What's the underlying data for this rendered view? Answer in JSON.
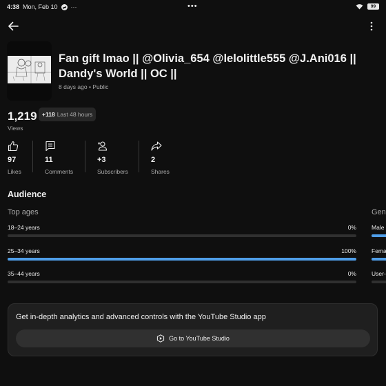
{
  "status_bar": {
    "time": "4:38",
    "date": "Mon, Feb 10",
    "notif_dots": "···",
    "center_dots": "•••",
    "battery": "99"
  },
  "video": {
    "title": "Fan gift lmao || @Olivia_654 @lelolittle555 @J.Ani016 || Dandy's World || OC ||",
    "meta": "8 days ago • Public"
  },
  "views": {
    "count": "1,219",
    "delta": "+118",
    "period": "Last 48 hours",
    "label": "Views"
  },
  "stats": [
    {
      "value": "97",
      "label": "Likes",
      "icon": "thumbs-up-icon"
    },
    {
      "value": "11",
      "label": "Comments",
      "icon": "comment-icon"
    },
    {
      "value": "+3",
      "label": "Subscribers",
      "icon": "person-add-icon"
    },
    {
      "value": "2",
      "label": "Shares",
      "icon": "share-icon"
    }
  ],
  "audience": {
    "title": "Audience",
    "top_ages": {
      "title": "Top ages",
      "rows": [
        {
          "label": "18–24 years",
          "value": "0%",
          "fraction": 0.0
        },
        {
          "label": "25–34 years",
          "value": "100%",
          "fraction": 1.0
        },
        {
          "label": "35–44 years",
          "value": "0%",
          "fraction": 0.0
        }
      ]
    },
    "gender": {
      "title": "Gen",
      "rows": [
        {
          "label": "Male",
          "fraction": 1.0
        },
        {
          "label": "Fema",
          "fraction": 1.0
        },
        {
          "label": "User-s",
          "fraction": 0.0
        }
      ]
    }
  },
  "promo": {
    "text": "Get in-depth analytics and advanced controls with the YouTube Studio app",
    "button_label": "Go to YouTube Studio"
  },
  "colors": {
    "background": "#0f0f0f",
    "accent_bar": "#4f9ee8",
    "card": "#1f1f1f"
  }
}
